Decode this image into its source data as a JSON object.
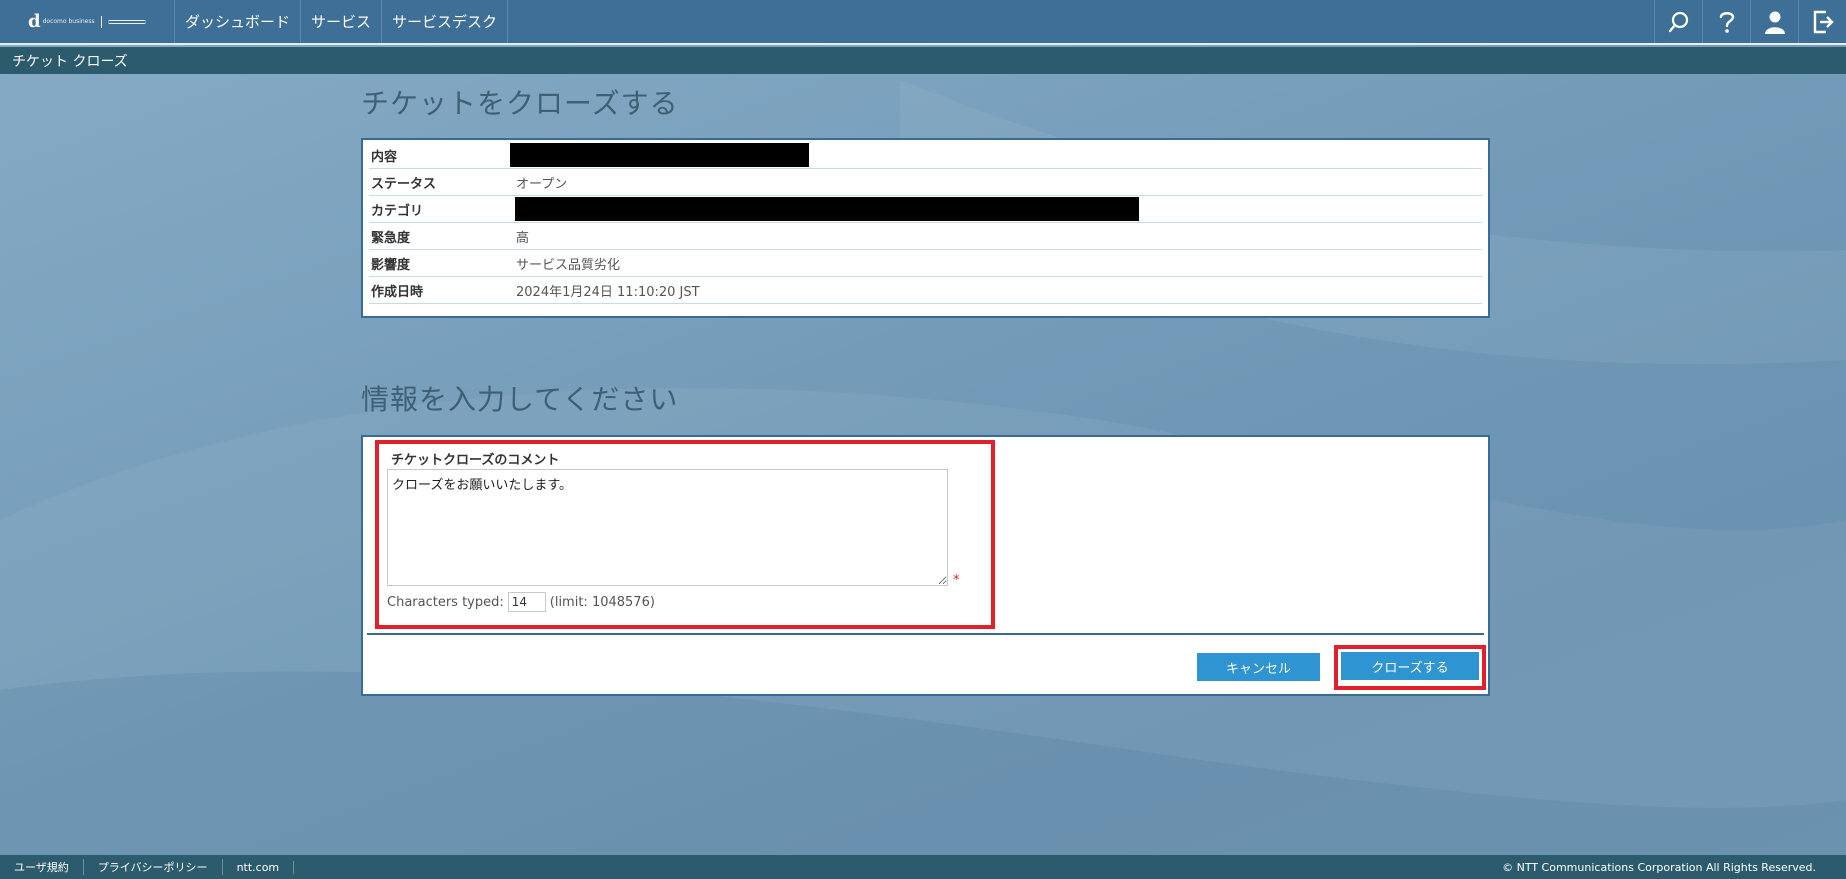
{
  "app": {
    "logo_text": "d",
    "logo_sub": "docomo business"
  },
  "nav": {
    "items": [
      "ダッシュボード",
      "サービス",
      "サービスデスク"
    ]
  },
  "breadcrumb": "チケット クローズ",
  "page": {
    "title": "チケットをクローズする",
    "section_title": "情報を入力してください"
  },
  "ticket": {
    "rows": [
      {
        "label": "内容",
        "value": ""
      },
      {
        "label": "ステータス",
        "value": "オープン"
      },
      {
        "label": "カテゴリ",
        "value": ""
      },
      {
        "label": "緊急度",
        "value": "高"
      },
      {
        "label": "影響度",
        "value": "サービス品質劣化"
      },
      {
        "label": "作成日時",
        "value": "2024年1月24日 11:10:20 JST"
      }
    ]
  },
  "form": {
    "comment_label": "チケットクローズのコメント",
    "comment_value": "クローズをお願いいたします。",
    "required_mark": "*",
    "chars_typed_label": "Characters typed:",
    "chars_typed_value": "14",
    "limit_text": "(limit: 1048576)"
  },
  "buttons": {
    "cancel": "キャンセル",
    "close": "クローズする"
  },
  "footer": {
    "links": [
      "ユーザ規約",
      "プライバシーポリシー",
      "ntt.com"
    ],
    "copyright": "© NTT Communications Corporation All Rights Reserved."
  },
  "colors": {
    "nav_bg": "#3d6f97",
    "crumb_bg": "#2c5b6e",
    "button": "#2f94d2",
    "highlight": "#e0202a"
  }
}
